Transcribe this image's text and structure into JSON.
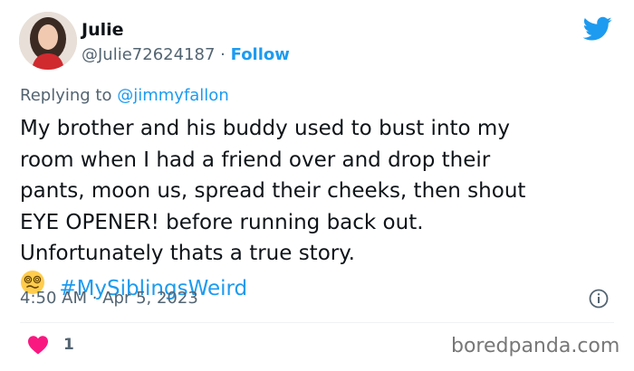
{
  "author": {
    "name": "Julie",
    "handle": "@Julie72624187",
    "separator": "·",
    "follow_label": "Follow"
  },
  "reply": {
    "prefix": "Replying to",
    "mention": "@jimmyfallon"
  },
  "tweet": {
    "lines": [
      "My brother and his buddy used to bust into my",
      "room when I had a friend over and drop their",
      "pants, moon us, spread their cheeks, then shout",
      "EYE OPENER! before running back out.",
      "Unfortunately thats a true story."
    ],
    "emoji": "woozy-face-emoji",
    "hashtag": "#MySiblingsWeird"
  },
  "meta": {
    "time": "4:50 AM",
    "separator": "·",
    "date": "Apr 5, 2023"
  },
  "engagement": {
    "like_count": "1"
  },
  "watermark": "boredpanda.com",
  "colors": {
    "accent": "#1d9bf0",
    "like": "#f91880",
    "muted": "#536471"
  }
}
